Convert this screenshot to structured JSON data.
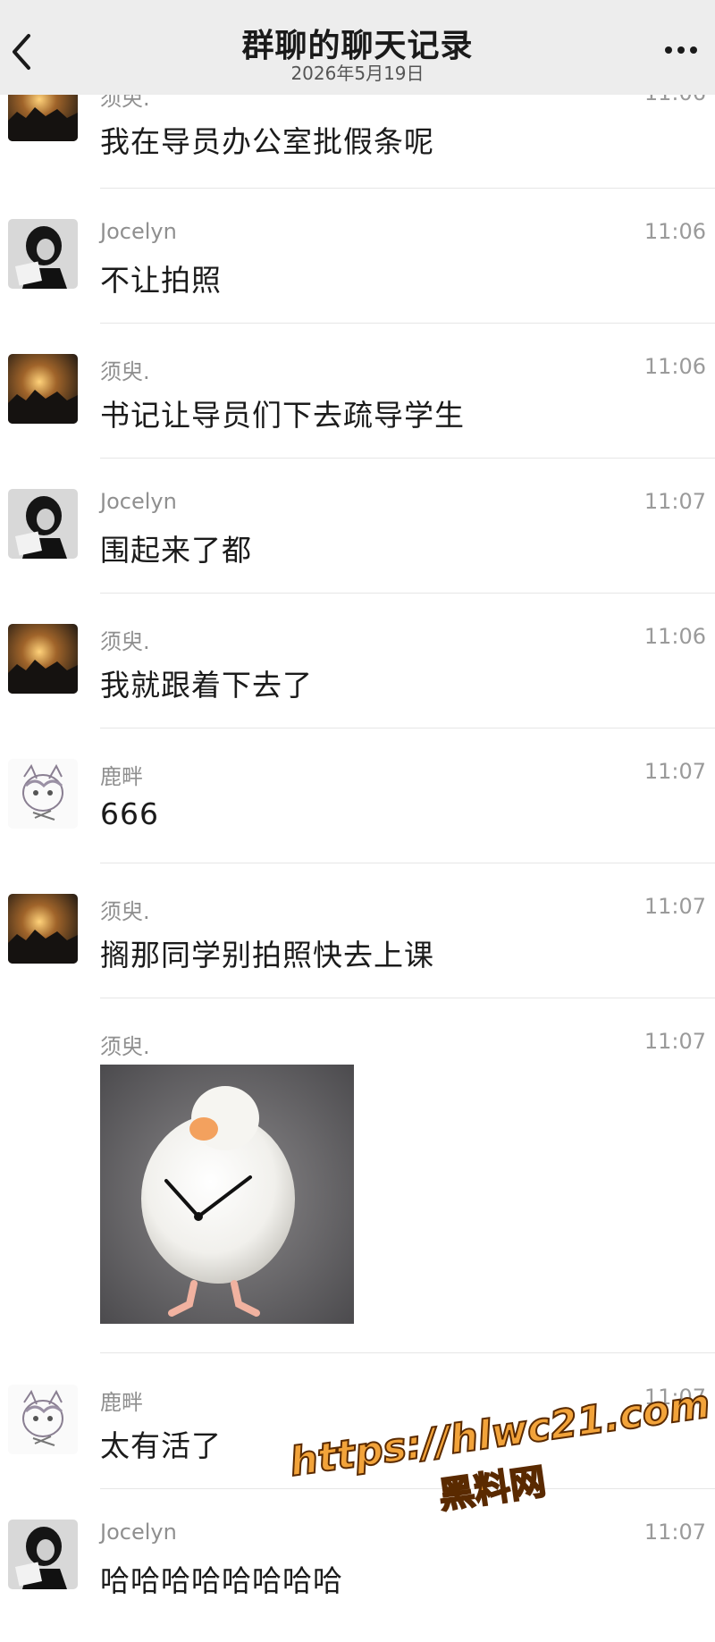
{
  "header": {
    "title": "群聊的聊天记录",
    "date": "2026年5月19日"
  },
  "messages": [
    {
      "sender": "须臾.",
      "time": "11:06",
      "text": "我在导员办公室批假条呢",
      "avatar": "sunset"
    },
    {
      "sender": "Jocelyn",
      "time": "11:06",
      "text": "不让拍照",
      "avatar": "portrait"
    },
    {
      "sender": "须臾.",
      "time": "11:06",
      "text": "书记让导员们下去疏导学生",
      "avatar": "sunset"
    },
    {
      "sender": "Jocelyn",
      "time": "11:07",
      "text": "围起来了都",
      "avatar": "portrait"
    },
    {
      "sender": "须臾.",
      "time": "11:06",
      "text": "我就跟着下去了",
      "avatar": "sunset"
    },
    {
      "sender": "鹿畔",
      "time": "11:07",
      "text": "666",
      "avatar": "cat"
    },
    {
      "sender": "须臾.",
      "time": "11:07",
      "text": "搁那同学别拍照快去上课",
      "avatar": "sunset"
    },
    {
      "sender": "须臾.",
      "time": "11:07",
      "sticker": "duck-clock-sticker"
    },
    {
      "sender": "鹿畔",
      "time": "11:07",
      "text": "太有活了",
      "avatar": "cat"
    },
    {
      "sender": "Jocelyn",
      "time": "11:07",
      "text": "哈哈哈哈哈哈哈哈",
      "avatar": "portrait"
    }
  ],
  "watermark": {
    "url": "https://hlwc21.com",
    "name": "黑料网"
  }
}
